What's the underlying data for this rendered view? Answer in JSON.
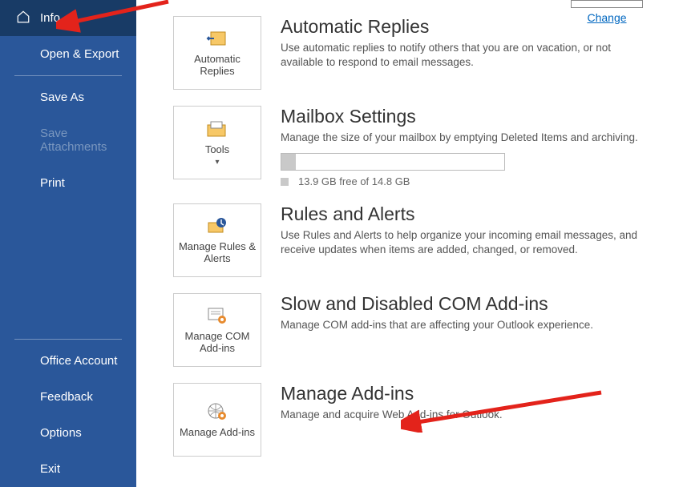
{
  "sidebar": {
    "items": [
      {
        "label": "Info"
      },
      {
        "label": "Open & Export"
      },
      {
        "label": "Save As"
      },
      {
        "label": "Save Attachments"
      },
      {
        "label": "Print"
      },
      {
        "label": "Office Account"
      },
      {
        "label": "Feedback"
      },
      {
        "label": "Options"
      },
      {
        "label": "Exit"
      }
    ]
  },
  "topright": {
    "change": "Change"
  },
  "rows": {
    "auto_replies": {
      "tile": "Automatic Replies",
      "title": "Automatic Replies",
      "desc": "Use automatic replies to notify others that you are on vacation, or not available to respond to email messages."
    },
    "mailbox": {
      "tile": "Tools",
      "title": "Mailbox Settings",
      "desc": "Manage the size of your mailbox by emptying Deleted Items and archiving.",
      "note": "13.9 GB free of 14.8 GB"
    },
    "rules": {
      "tile": "Manage Rules & Alerts",
      "title": "Rules and Alerts",
      "desc": "Use Rules and Alerts to help organize your incoming email messages, and receive updates when items are added, changed, or removed."
    },
    "com": {
      "tile": "Manage COM Add-ins",
      "title": "Slow and Disabled COM Add-ins",
      "desc": "Manage COM add-ins that are affecting your Outlook experience."
    },
    "addins": {
      "tile": "Manage Add-ins",
      "title": "Manage Add-ins",
      "desc": "Manage and acquire Web Add-ins for Outlook."
    }
  }
}
